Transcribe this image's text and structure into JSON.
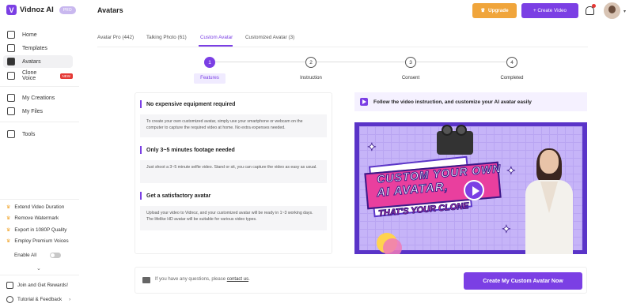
{
  "app": {
    "name": "Vidnoz AI",
    "badge": "PRO"
  },
  "sidebar": {
    "items": [
      {
        "label": "Home",
        "icon": "home-icon"
      },
      {
        "label": "Templates",
        "icon": "templates-icon"
      },
      {
        "label": "Avatars",
        "icon": "avatars-icon"
      },
      {
        "label": "Clone Voice",
        "icon": "microphone-icon",
        "badge": "NEW"
      },
      {
        "label": "My Creations",
        "icon": "play-icon"
      },
      {
        "label": "My Files",
        "icon": "folder-icon"
      },
      {
        "label": "Tools",
        "icon": "tools-icon"
      }
    ],
    "promos": [
      "Extend Video Duration",
      "Remove Watermark",
      "Export in 1080P Quality",
      "Employ Premium Voices"
    ],
    "enable_all": "Enable All",
    "footer": [
      "Join and Get Rewards!",
      "Tutorial & Feedback"
    ]
  },
  "header": {
    "title": "Avatars",
    "upgrade": "Upgrade",
    "create_video": "+ Create Video"
  },
  "tabs": [
    "Avatar Pro (442)",
    "Talking Photo (61)",
    "Custom Avatar",
    "Customized Avatar (3)"
  ],
  "steps": [
    {
      "num": "1",
      "label": "Features"
    },
    {
      "num": "2",
      "label": "Instruction"
    },
    {
      "num": "3",
      "label": "Consent"
    },
    {
      "num": "4",
      "label": "Completed"
    }
  ],
  "features": [
    {
      "title": "No expensive equipment required",
      "body": "To create your own customized avatar, simply use your smartphone or webcam on the computer to capture the required video at home. No extra expenses needed."
    },
    {
      "title": "Only 3~5 minutes footage needed",
      "body": "Just shoot a 3~5 minute selfie video. Stand or sit, you can capture the video as easy as usual."
    },
    {
      "title": "Get a satisfactory avatar",
      "body": "Upload your video to Vidnoz, and your customized avatar will be ready in 1~3 working days. The lifelike HD avatar will be suitable for various video types."
    }
  ],
  "video": {
    "instruction": "Follow the video instruction, and customize your AI avatar easily",
    "line1": "CUSTOM YOUR OWN",
    "line2": "AI AVATAR,",
    "line3": "THAT'S YOUR CLONE"
  },
  "footer": {
    "question": "If you have any questions, please",
    "contact": "contact us",
    "period": ".",
    "create_button": "Create My Custom Avatar Now"
  },
  "colors": {
    "accent": "#7b3fe4",
    "upgrade": "#f0a53b",
    "pink": "#e93f9e"
  }
}
